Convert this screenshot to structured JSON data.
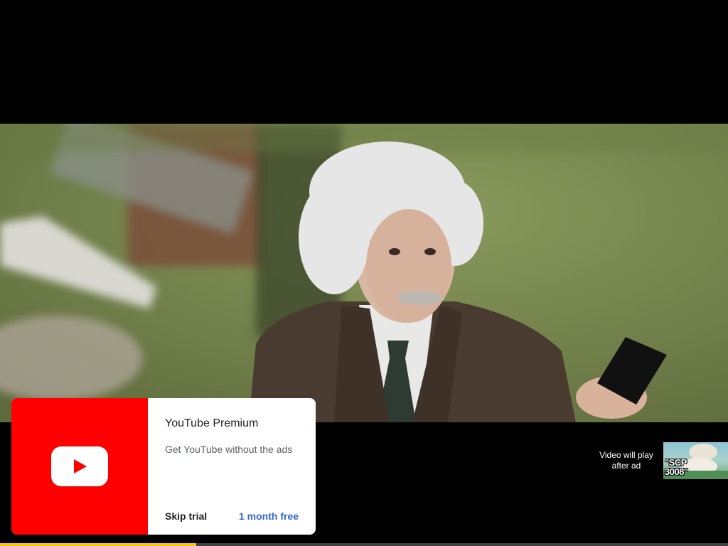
{
  "ad": {
    "title": "YouTube Premium",
    "subtitle": "Get YouTube without the ads",
    "skip_label": "Skip trial",
    "cta_label": "1 month free",
    "logo_icon": "youtube-play-icon",
    "brand_color": "#ff0000",
    "cta_color": "#3367d6"
  },
  "up_next": {
    "line1": "Video will play",
    "line2": "after ad",
    "thumbnail_title": "\"SCP\n3008\""
  },
  "progress": {
    "fraction": 0.27,
    "color": "#f5c518"
  }
}
